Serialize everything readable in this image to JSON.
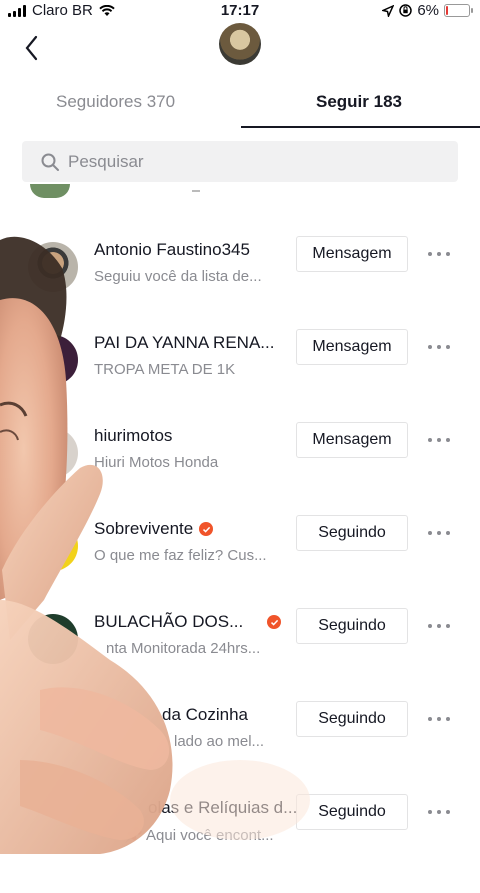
{
  "status_bar": {
    "carrier": "Claro BR",
    "time": "17:17",
    "battery": "6%"
  },
  "tabs": {
    "followers": "Seguidores 370",
    "following": "Seguir 183"
  },
  "search": {
    "placeholder": "Pesquisar"
  },
  "rows": [
    {
      "name": "Antonio Faustino345",
      "subtitle": "Seguiu você da lista de...",
      "button": "Mensagem",
      "verified": false
    },
    {
      "name": "PAI DA YANNA RENA...",
      "subtitle": "TROPA META DE 1K",
      "button": "Mensagem",
      "verified": false
    },
    {
      "name": "hiurimotos",
      "subtitle": "Hiuri Motos Honda",
      "button": "Mensagem",
      "verified": false
    },
    {
      "name": "Sobrevivente",
      "subtitle": "O que me faz feliz? Cus...",
      "button": "Seguindo",
      "verified": true
    },
    {
      "name": "BULACHÃO DOS...",
      "subtitle": "nta Monitorada 24hrs...",
      "button": "Seguindo",
      "verified": true
    },
    {
      "name": "da Cozinha",
      "subtitle": "lado ao mel...",
      "button": "Seguindo",
      "verified": false
    },
    {
      "name": "olas e Relíquias d...",
      "subtitle": "📌 Aqui você encont...",
      "button": "Seguindo",
      "verified": false
    }
  ],
  "colors": {
    "accent": "#161823",
    "secondary": "#8a8b91",
    "verified": "#f0542a"
  }
}
